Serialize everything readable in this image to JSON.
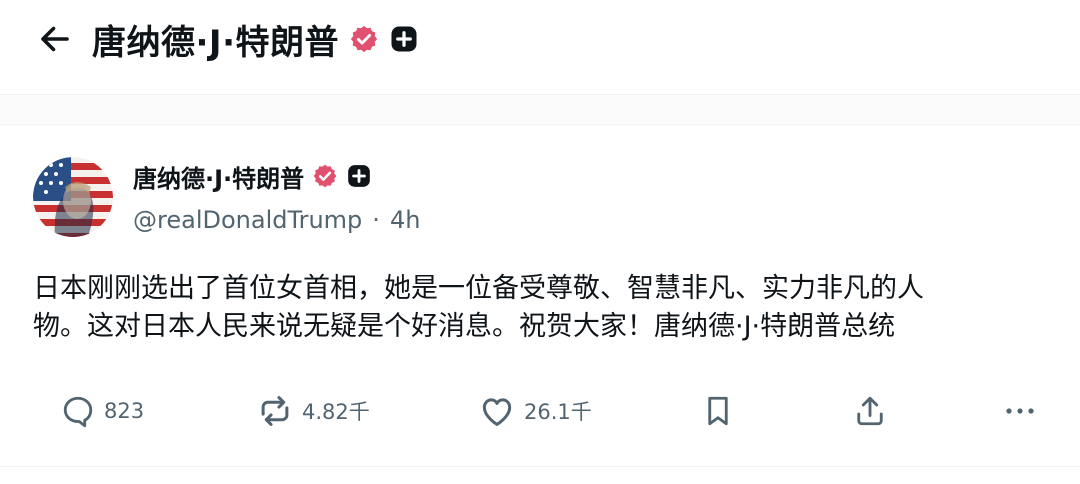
{
  "header": {
    "title": "唐纳德·J·特朗普"
  },
  "post": {
    "author_name": "唐纳德·J·特朗普",
    "handle": "@realDonaldTrump",
    "separator": "·",
    "time": "4h",
    "text_line1": "日本刚刚选出了首位女首相，她是一位备受尊敬、智慧非凡、实力非凡的人",
    "text_line2": "物。这对日本人民来说无疑是个好消息。祝贺大家！唐纳德·J·特朗普总统"
  },
  "actions": {
    "replies": "823",
    "reposts": "4.82千",
    "likes": "26.1千"
  },
  "icons": {
    "back": "arrow-left-icon",
    "verified": "verified-badge-icon",
    "extra_badge": "plus-badge-icon",
    "reply": "reply-bubble-icon",
    "repost": "repost-icon",
    "like": "heart-icon",
    "bookmark": "bookmark-icon",
    "share": "share-icon",
    "more": "more-icon"
  },
  "colors": {
    "verified_badge": "#e0506f",
    "text_primary": "#0f1419",
    "text_secondary": "#536471"
  }
}
